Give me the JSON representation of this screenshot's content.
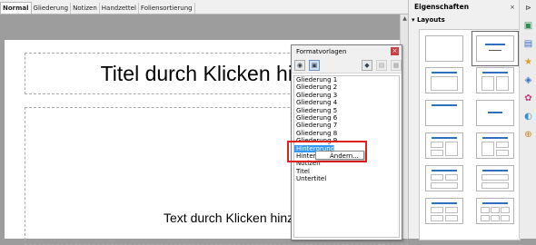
{
  "view_tabs": [
    "Normal",
    "Gliederung",
    "Notizen",
    "Handzettel",
    "Foliensortierung"
  ],
  "slide": {
    "title_placeholder": "Titel durch Klicken hinzuf",
    "body_placeholder": "Text durch Klicken hinzufügen"
  },
  "dialog": {
    "title": "Formatvorlagen",
    "styles": [
      "Gliederung 1",
      "Gliederung 2",
      "Gliederung 3",
      "Gliederung 4",
      "Gliederung 5",
      "Gliederung 6",
      "Gliederung 7",
      "Gliederung 8",
      "Gliederung 9",
      "Hintergrund",
      "Hinterg",
      "Notizen",
      "Titel",
      "Untertitel"
    ],
    "selected_index": 9
  },
  "context_menu": {
    "item": "Ändern..."
  },
  "sidebar": {
    "title": "Eigenschaften",
    "section": "Layouts",
    "close_glyph": "×",
    "collapse_glyph": "▾"
  },
  "colors": {
    "accent": "#2f6fbd",
    "highlight": "#e01f1f",
    "selection": "#3399ff"
  },
  "icons": [
    "close-icon",
    "fill-format-icon",
    "new-style-icon",
    "update-style-icon",
    "styles-icon",
    "properties-icon",
    "slide-transition-icon",
    "animation-icon",
    "navigator-icon",
    "gallery-icon",
    "master-slides-icon"
  ]
}
